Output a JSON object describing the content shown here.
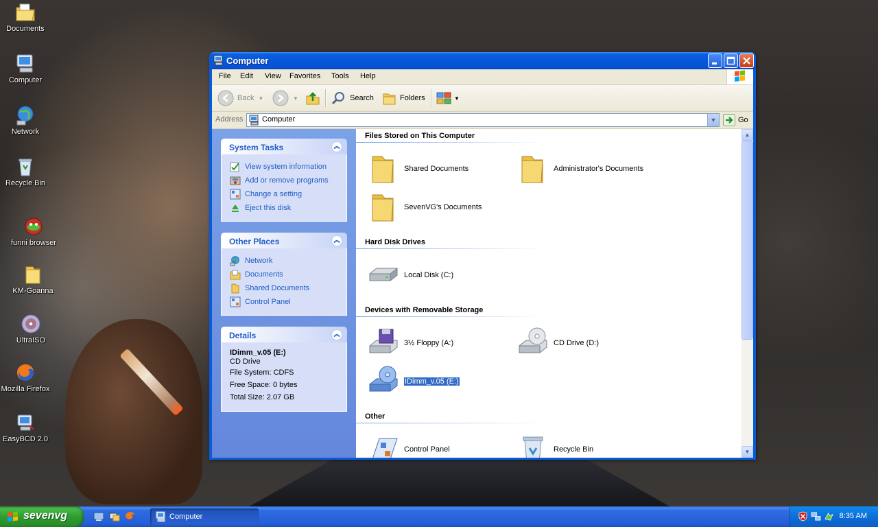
{
  "desktop": {
    "icons": [
      {
        "label": "Documents",
        "icon": "documents-folder-icon"
      },
      {
        "label": "Computer",
        "icon": "computer-icon"
      },
      {
        "label": "Network",
        "icon": "network-icon"
      },
      {
        "label": "Recycle Bin",
        "icon": "recycle-bin-icon"
      },
      {
        "label": "funni browser",
        "icon": "browser-icon"
      },
      {
        "label": "KM-Goanna",
        "icon": "folder-icon"
      },
      {
        "label": "UltraISO",
        "icon": "disc-icon"
      },
      {
        "label": "Mozilla Firefox",
        "icon": "firefox-icon"
      },
      {
        "label": "EasyBCD 2.0",
        "icon": "easybcd-icon"
      }
    ]
  },
  "window": {
    "title": "Computer",
    "menu": [
      "File",
      "Edit",
      "View",
      "Favorites",
      "Tools",
      "Help"
    ],
    "toolbar": {
      "back": "Back",
      "search": "Search",
      "folders": "Folders"
    },
    "address": {
      "label": "Address",
      "value": "Computer",
      "go": "Go"
    },
    "taskpane": {
      "system_tasks": {
        "title": "System Tasks",
        "items": [
          "View system information",
          "Add or remove programs",
          "Change a setting",
          "Eject this disk"
        ]
      },
      "other_places": {
        "title": "Other Places",
        "items": [
          "Network",
          "Documents",
          "Shared Documents",
          "Control Panel"
        ]
      },
      "details": {
        "title": "Details",
        "name": "IDimm_v.05 (E:)",
        "type": "CD Drive",
        "file_system": "File System: CDFS",
        "free_space": "Free Space: 0 bytes",
        "total_size": "Total Size: 2.07 GB"
      }
    },
    "groups": {
      "files": {
        "title": "Files Stored on This Computer",
        "items": [
          "Shared Documents",
          "Administrator's Documents",
          "SevenVG's Documents"
        ]
      },
      "hdd": {
        "title": "Hard Disk Drives",
        "items": [
          "Local Disk (C:)"
        ]
      },
      "removable": {
        "title": "Devices with Removable Storage",
        "items": [
          "3½ Floppy (A:)",
          "CD Drive (D:)",
          "IDimm_v.05 (E:)"
        ]
      },
      "other": {
        "title": "Other",
        "items": [
          "Control Panel",
          "Recycle Bin"
        ]
      }
    }
  },
  "taskbar": {
    "start_label": "sevenvg",
    "task_button": "Computer",
    "clock": "8:35 AM"
  },
  "colors": {
    "titlebar": "#0a5bd8",
    "taskpane": "#6f93de",
    "link": "#215dc6",
    "selection": "#316ac5",
    "start_green": "#3c9c3c"
  }
}
